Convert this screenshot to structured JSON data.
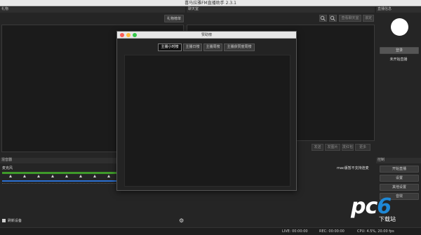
{
  "window": {
    "title": "喜马拉雅FM直播助手 2.3.1"
  },
  "gift_panel": {
    "header": "礼物",
    "button": "礼物榜单"
  },
  "mixer": {
    "header": "混音器",
    "device_label": "麦克风"
  },
  "bottom_left": {
    "refresh_label": "刷新设备"
  },
  "chat": {
    "header": "聊天室",
    "toolbar": [
      {
        "label": ""
      },
      {
        "label": ""
      },
      {
        "label": "查看聊天室"
      },
      {
        "label": "滚定"
      }
    ],
    "actions": [
      {
        "label": "发送"
      },
      {
        "label": "发图片"
      },
      {
        "label": "发红包"
      },
      {
        "label": "更多"
      }
    ],
    "mac_note": "mac版暂不支持连麦"
  },
  "live_info": {
    "header": "直播信息",
    "login_button": "登录",
    "status": "未开始直播"
  },
  "control": {
    "header": "控制",
    "buttons": [
      {
        "label": "开始直播"
      },
      {
        "label": "设置"
      },
      {
        "label": "其他设置"
      },
      {
        "label": "音效"
      }
    ]
  },
  "statusbar": {
    "live": "LIVE: 00:00:00",
    "rec": "REC: 00:00:00",
    "cpu": "CPU: 4.5%, 20.00 fps"
  },
  "modal": {
    "title": "赞助榜",
    "tabs": [
      {
        "label": "主播小时榜",
        "active": true
      },
      {
        "label": "主播日榜",
        "active": false
      },
      {
        "label": "主播周榜",
        "active": false
      },
      {
        "label": "主播获赞度周榜",
        "active": false
      }
    ]
  },
  "watermark": {
    "logo_pc": "pc",
    "logo_6": "6",
    "logo_com": "com",
    "sub": "下载站"
  },
  "colors": {
    "meter_green": "#3f9a2a",
    "meter_blue": "#2a6fd1",
    "close_red": "#fc5c56",
    "min_yellow": "#fdbc40",
    "max_green": "#33c748"
  }
}
